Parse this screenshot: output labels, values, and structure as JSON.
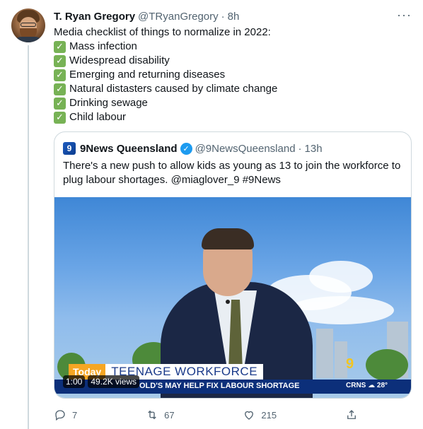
{
  "author": {
    "display_name": "T. Ryan Gregory",
    "handle": "@TRyanGregory",
    "separator": "·",
    "time": "8h"
  },
  "more_label": "···",
  "tweet": {
    "intro": "Media checklist of things to normalize in 2022:",
    "checklist": [
      "Mass infection",
      "Widespread disability",
      "Emerging and returning diseases",
      "Natural distasters caused by climate change",
      "Drinking sewage",
      "Child labour"
    ],
    "check_glyph": "✓"
  },
  "quote": {
    "logo_glyph": "9",
    "name": "9News Queensland",
    "verified_glyph": "✓",
    "handle": "@9NewsQueensland",
    "separator": "·",
    "time": "13h",
    "text": "There's a new push to allow kids as young as 13 to join the workforce to plug labour shortages. @miaglover_9 #9News",
    "video": {
      "today_tag": "Today",
      "headline": "TEENAGE WORKFORCE",
      "ticker": "OLD'S MAY HELP FIX LABOUR SHORTAGE",
      "weather": "CRNS ☁ 28°",
      "watermark": "9",
      "duration": "1:00",
      "views": "49.2K views"
    }
  },
  "actions": {
    "replies": "7",
    "retweets": "67",
    "likes": "215"
  },
  "colors": {
    "text": "#0f1419",
    "muted": "#536471",
    "check": "#77b255",
    "verified": "#1d9bf0",
    "border": "#cfd9de"
  }
}
